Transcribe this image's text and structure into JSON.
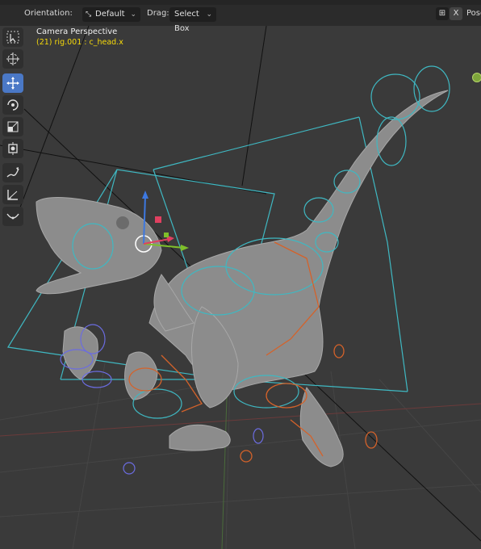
{
  "header": {
    "orientation_label": "Orientation:",
    "orientation_value": "Default",
    "drag_label": "Drag:",
    "drag_value": "Select Box",
    "pose_label": "Pose",
    "close_glyph": "X"
  },
  "viewport": {
    "title": "Camera Perspective",
    "subtitle": "(21) rig.001 : c_head.x"
  },
  "toolbar": {
    "tools": [
      {
        "name": "select-box-icon",
        "active": false
      },
      {
        "name": "cursor-icon",
        "active": false
      },
      {
        "name": "move-icon",
        "active": true
      },
      {
        "name": "rotate-icon",
        "active": false
      },
      {
        "name": "scale-icon",
        "active": false
      },
      {
        "name": "transform-icon",
        "active": false
      },
      {
        "name": "annotate-icon",
        "active": false
      },
      {
        "name": "measure-icon",
        "active": false
      },
      {
        "name": "relax-icon",
        "active": false
      }
    ]
  },
  "colors": {
    "viewport_bg": "#3a3a3a",
    "header_bg": "#2b2b2b",
    "active_tool": "#4a78c6",
    "bone_cyan": "#3fb8c2",
    "bone_orange": "#d4622a",
    "bone_purple": "#6b6ce0",
    "selection_yellow": "#f6d90a"
  }
}
